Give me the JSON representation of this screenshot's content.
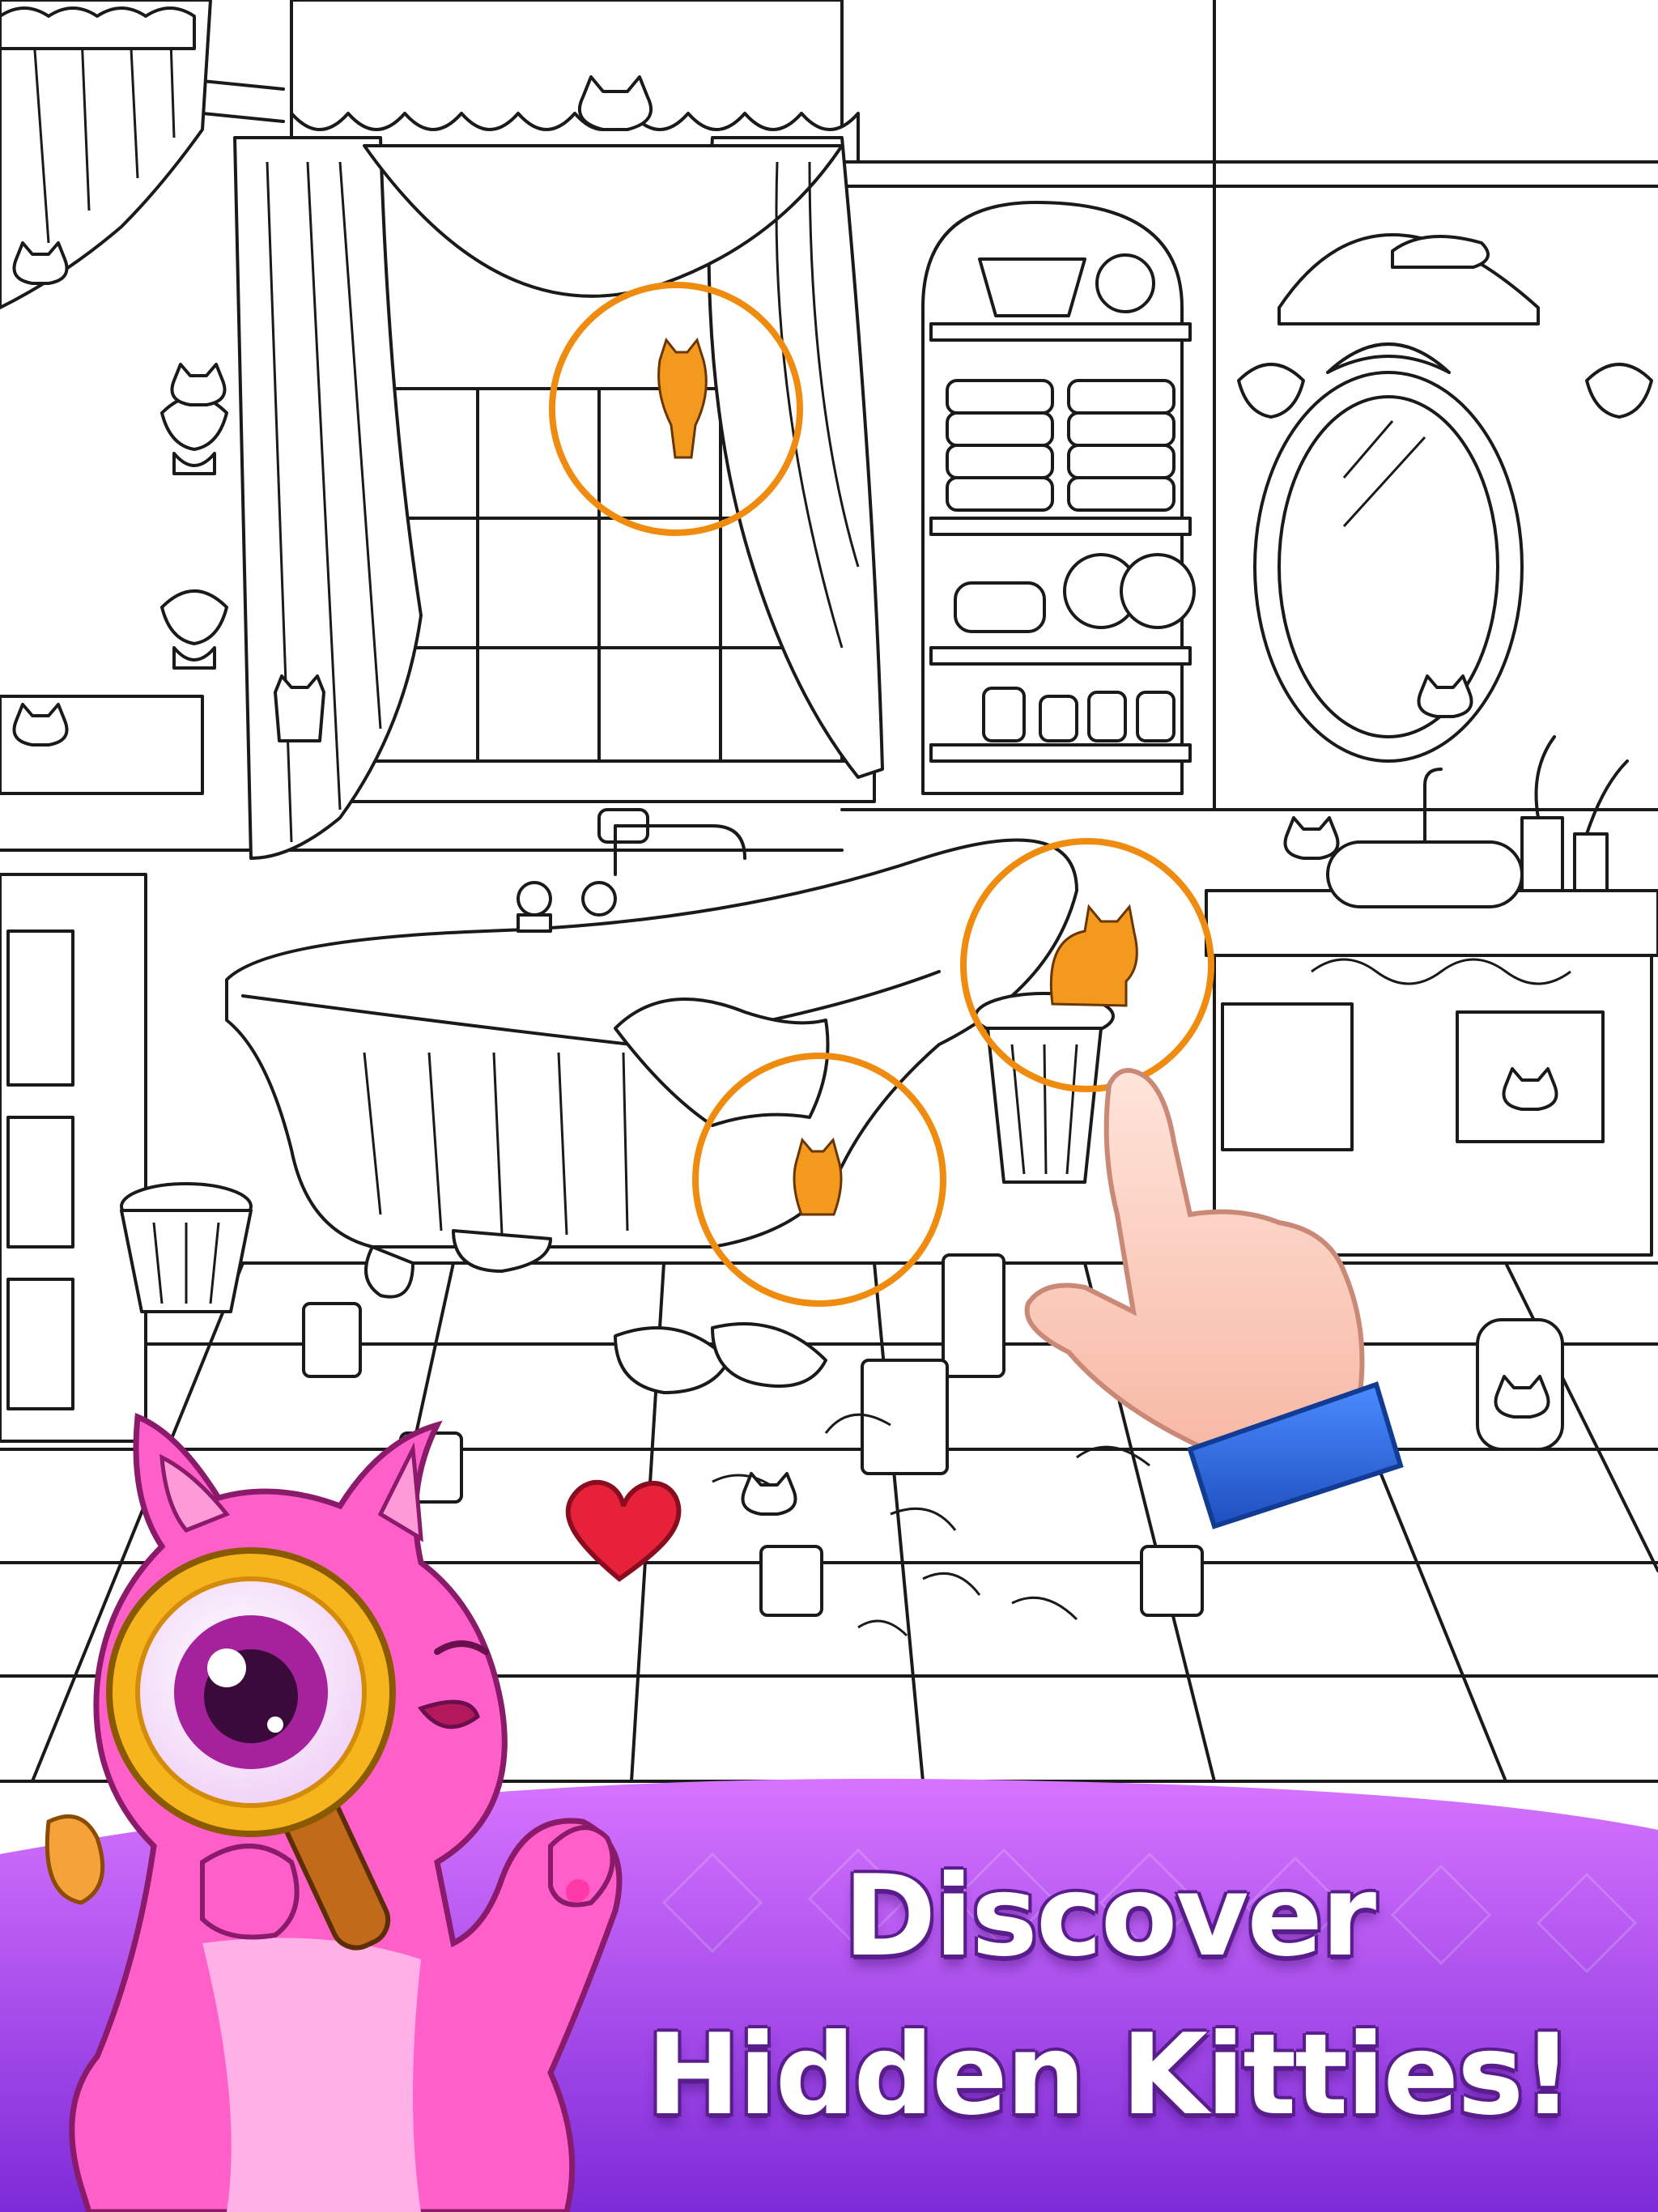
{
  "banner": {
    "line1": "Discover",
    "line2": "Hidden Kitties!",
    "gradient_top": "#d774ff",
    "gradient_bottom": "#7d2bd8"
  },
  "scene": {
    "room": "bathroom",
    "found_cat_color": "#f39a1e",
    "ring_color": "#ef8c10",
    "line_color": "#1a1a1a"
  },
  "mascot": {
    "body_color": "#ff5fc8",
    "lens_color": "#f6b51c"
  },
  "hint_hand": {
    "cuff_color": "#2f6fe0",
    "skin_color": "#ffd7c8"
  },
  "heart": {
    "color": "#e8213a"
  }
}
